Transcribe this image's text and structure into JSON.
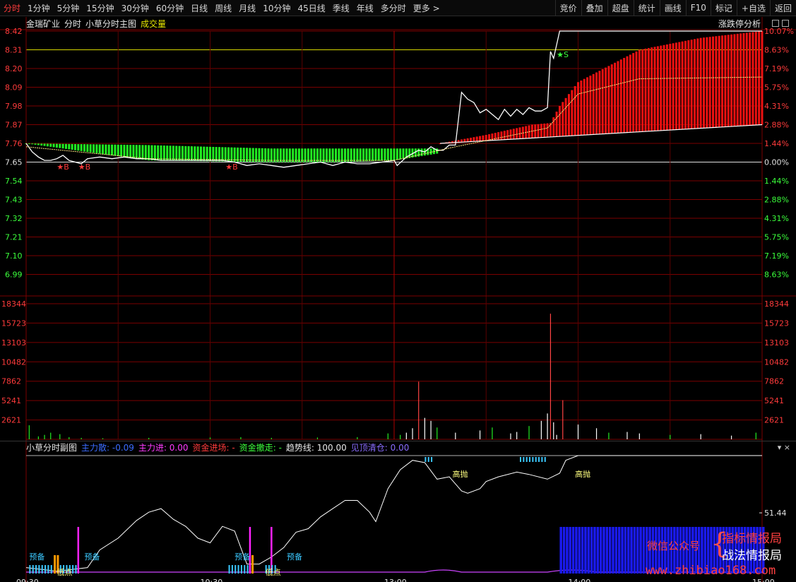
{
  "nav": {
    "tabs": [
      "分时",
      "1分钟",
      "5分钟",
      "15分钟",
      "30分钟",
      "60分钟",
      "日线",
      "周线",
      "月线",
      "10分钟",
      "45日线",
      "季线",
      "年线",
      "多分时",
      "更多 >"
    ],
    "active": 0,
    "actions": [
      "竞价",
      "叠加",
      "超盘",
      "统计",
      "画线",
      "F10",
      "标记",
      "+自选",
      "返回"
    ]
  },
  "main": {
    "stock": "金瑞矿业",
    "mode": "分时",
    "indicator": "小草分时主图",
    "volume_label": "成交量",
    "zt_label": "涨跌停分析"
  },
  "sub": {
    "title": "小草分时副图",
    "items": [
      {
        "label": "主力散: -0.09",
        "color": "#3b6cff"
      },
      {
        "label": "主力进: 0.00",
        "color": "#ff3bff"
      },
      {
        "label": "资金进场: -",
        "color": "#ff3b3b"
      },
      {
        "label": "资金撤走: -",
        "color": "#3bff3b"
      },
      {
        "label": "趋势线: 100.00",
        "color": "#e8e8e8"
      },
      {
        "label": "见顶清仓: 0.00",
        "color": "#8a6cff"
      }
    ],
    "ctrl": "▾  ×"
  },
  "axis": {
    "price_left": [
      "8.42",
      "8.31",
      "8.20",
      "8.09",
      "7.98",
      "7.87",
      "7.76",
      "7.65",
      "7.54",
      "7.43",
      "7.32",
      "7.21",
      "7.10",
      "6.99"
    ],
    "pct_right": [
      "10.07%",
      "8.63%",
      "7.19%",
      "5.75%",
      "4.31%",
      "2.88%",
      "1.44%",
      "0.00%",
      "1.44%",
      "2.88%",
      "4.31%",
      "5.75%",
      "7.19%",
      "8.63%"
    ],
    "vol_labels": [
      "18344",
      "15723",
      "13103",
      "10482",
      "7862",
      "5241",
      "2621"
    ],
    "sub_right": [
      "51.44"
    ],
    "time_labels": [
      "09:30",
      "10:30",
      "13:00",
      "14:00",
      "15:00"
    ]
  },
  "signals": {
    "markers": [
      {
        "text": "★B",
        "minute": 10,
        "price": 7.64,
        "color": "#ff3b3b"
      },
      {
        "text": "★B",
        "minute": 17,
        "price": 7.64,
        "color": "#ff3b3b"
      },
      {
        "text": "★B",
        "minute": 65,
        "price": 7.64,
        "color": "#ff3b3b"
      },
      {
        "text": "★S",
        "minute": 173,
        "price": 8.3,
        "color": "#3bff3b"
      }
    ],
    "sub_labels": [
      {
        "text": "预备",
        "minute": 1,
        "color": "#3bc8ff"
      },
      {
        "text": "预备",
        "minute": 19,
        "color": "#3bc8ff"
      },
      {
        "text": "预备",
        "minute": 68,
        "color": "#3bc8ff"
      },
      {
        "text": "预备",
        "minute": 85,
        "color": "#3bc8ff"
      },
      {
        "text": "低点",
        "minute": 10,
        "color": "#ffff80"
      },
      {
        "text": "低点",
        "minute": 78,
        "color": "#ffff80"
      },
      {
        "text": "高抛",
        "minute": 139,
        "color": "#ffff80"
      },
      {
        "text": "高抛",
        "minute": 179,
        "color": "#ffff80"
      }
    ]
  },
  "watermark": {
    "wx": "微信公众号",
    "line1": "指标情报局",
    "line2": "战法情报局",
    "url": "www.zhibiao168.com"
  },
  "chart_data": {
    "type": "line",
    "title": "",
    "price_range": [
      6.93,
      8.42
    ],
    "base_price": 7.65,
    "limit_up": 8.42,
    "yellow_line": 8.31,
    "price_series": {
      "minutes": [
        0,
        2,
        4,
        6,
        8,
        10,
        12,
        14,
        16,
        18,
        20,
        24,
        28,
        32,
        36,
        40,
        44,
        48,
        52,
        56,
        60,
        64,
        68,
        72,
        76,
        80,
        84,
        88,
        92,
        96,
        100,
        104,
        108,
        112,
        116,
        120,
        121,
        124,
        126,
        128,
        130,
        132,
        134,
        136,
        138,
        140,
        142,
        144,
        146,
        148,
        150,
        154,
        156,
        158,
        160,
        162,
        164,
        166,
        168,
        170,
        171,
        172,
        174,
        176,
        178,
        180,
        200,
        240
      ],
      "prices": [
        7.76,
        7.71,
        7.68,
        7.66,
        7.66,
        7.67,
        7.69,
        7.66,
        7.65,
        7.64,
        7.67,
        7.68,
        7.67,
        7.68,
        7.67,
        7.67,
        7.66,
        7.66,
        7.66,
        7.66,
        7.66,
        7.66,
        7.65,
        7.63,
        7.64,
        7.63,
        7.62,
        7.63,
        7.64,
        7.65,
        7.63,
        7.65,
        7.64,
        7.64,
        7.65,
        7.66,
        7.63,
        7.68,
        7.7,
        7.72,
        7.71,
        7.74,
        7.72,
        7.72,
        7.75,
        7.75,
        8.06,
        8.02,
        8.0,
        7.94,
        7.96,
        7.9,
        7.96,
        7.92,
        7.96,
        7.93,
        7.97,
        7.95,
        7.95,
        7.97,
        8.3,
        8.26,
        8.42,
        8.42,
        8.42,
        8.42,
        8.42,
        8.42
      ]
    },
    "bars": {
      "green_range": [
        0,
        134
      ],
      "red_range": [
        135,
        240
      ],
      "green_top": [
        [
          0,
          7.76
        ],
        [
          40,
          7.75
        ],
        [
          80,
          7.73
        ],
        [
          100,
          7.73
        ],
        [
          120,
          7.73
        ],
        [
          134,
          7.73
        ]
      ],
      "green_bottom": [
        [
          0,
          7.76
        ],
        [
          40,
          7.66
        ],
        [
          80,
          7.65
        ],
        [
          100,
          7.65
        ],
        [
          120,
          7.66
        ],
        [
          134,
          7.7
        ]
      ],
      "red_top": [
        [
          135,
          7.76
        ],
        [
          150,
          7.81
        ],
        [
          165,
          7.87
        ],
        [
          171,
          7.88
        ],
        [
          174,
          7.98
        ],
        [
          180,
          8.12
        ],
        [
          200,
          8.31
        ],
        [
          220,
          8.38
        ],
        [
          240,
          8.42
        ]
      ],
      "red_bottom": [
        [
          135,
          7.76
        ],
        [
          240,
          7.87
        ]
      ]
    },
    "volume_max": 18344,
    "volume_series": {
      "minutes": [
        1,
        4,
        6,
        8,
        11,
        14,
        18,
        25,
        40,
        60,
        70,
        80,
        95,
        108,
        118,
        122,
        124,
        126,
        128,
        130,
        132,
        134,
        140,
        148,
        152,
        158,
        160,
        164,
        168,
        170,
        171,
        172,
        173,
        175,
        180,
        186,
        190,
        196,
        200,
        210,
        220,
        230,
        238
      ],
      "values": [
        1900,
        400,
        600,
        900,
        700,
        300,
        200,
        150,
        200,
        250,
        300,
        200,
        250,
        300,
        800,
        600,
        900,
        1500,
        7800,
        2900,
        2500,
        1600,
        900,
        1200,
        1600,
        800,
        1000,
        1800,
        2500,
        3500,
        17000,
        2300,
        600,
        5300,
        2000,
        1500,
        900,
        1000,
        800,
        600,
        700,
        500,
        900
      ]
    },
    "sub_series": {
      "range": [
        0,
        100
      ],
      "minutes": [
        0,
        10,
        20,
        24,
        30,
        36,
        40,
        44,
        48,
        52,
        56,
        60,
        64,
        68,
        72,
        76,
        80,
        84,
        88,
        92,
        96,
        100,
        104,
        108,
        112,
        114,
        118,
        122,
        126,
        130,
        134,
        138,
        140,
        142,
        144,
        148,
        150,
        154,
        160,
        164,
        170,
        174,
        176,
        180,
        190,
        200,
        240
      ],
      "values": [
        5,
        2,
        5,
        20,
        30,
        45,
        52,
        55,
        46,
        40,
        30,
        26,
        40,
        36,
        8,
        8,
        14,
        22,
        35,
        38,
        48,
        55,
        62,
        62,
        52,
        44,
        72,
        88,
        96,
        94,
        80,
        82,
        76,
        70,
        68,
        72,
        78,
        82,
        86,
        84,
        80,
        85,
        96,
        100,
        100,
        100,
        100
      ]
    }
  }
}
